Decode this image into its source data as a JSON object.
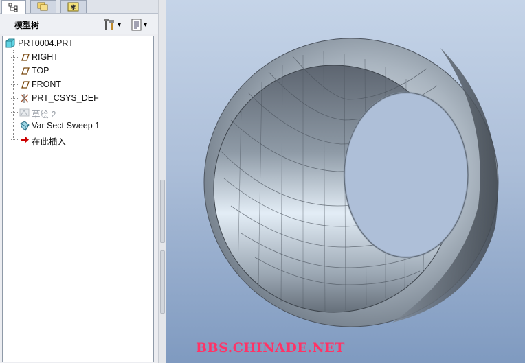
{
  "tabs": [
    {
      "name": "model-tree-tab",
      "icon": "tree-icon"
    },
    {
      "name": "layers-tab",
      "icon": "folder-layers-icon"
    },
    {
      "name": "favorites-tab",
      "icon": "star-icon"
    }
  ],
  "panel": {
    "title": "模型树",
    "settings_icon": "tools-icon",
    "show_icon": "list-icon",
    "dropdown_arrow": "▾"
  },
  "tree": {
    "root": {
      "label": "PRT0004.PRT",
      "icon": "part-icon"
    },
    "items": [
      {
        "label": "RIGHT",
        "icon": "datum-plane-icon",
        "dimmed": false
      },
      {
        "label": "TOP",
        "icon": "datum-plane-icon",
        "dimmed": false
      },
      {
        "label": "FRONT",
        "icon": "datum-plane-icon",
        "dimmed": false
      },
      {
        "label": "PRT_CSYS_DEF",
        "icon": "csys-icon",
        "dimmed": false
      },
      {
        "label": "草绘 2",
        "icon": "sketch-icon",
        "dimmed": true
      },
      {
        "label": "Var Sect Sweep 1",
        "icon": "sweep-icon",
        "dimmed": false
      },
      {
        "label": "在此插入",
        "icon": "insert-arrow-icon",
        "dimmed": false
      }
    ]
  },
  "viewport": {
    "watermark": "BBS.CHINADE.NET",
    "model": "shaded-ring-sweep"
  },
  "colors": {
    "viewport_top": "#c5d4e8",
    "viewport_bottom": "#7f9ac0",
    "watermark": "#ff3366",
    "insert_arrow": "#cc0000"
  }
}
